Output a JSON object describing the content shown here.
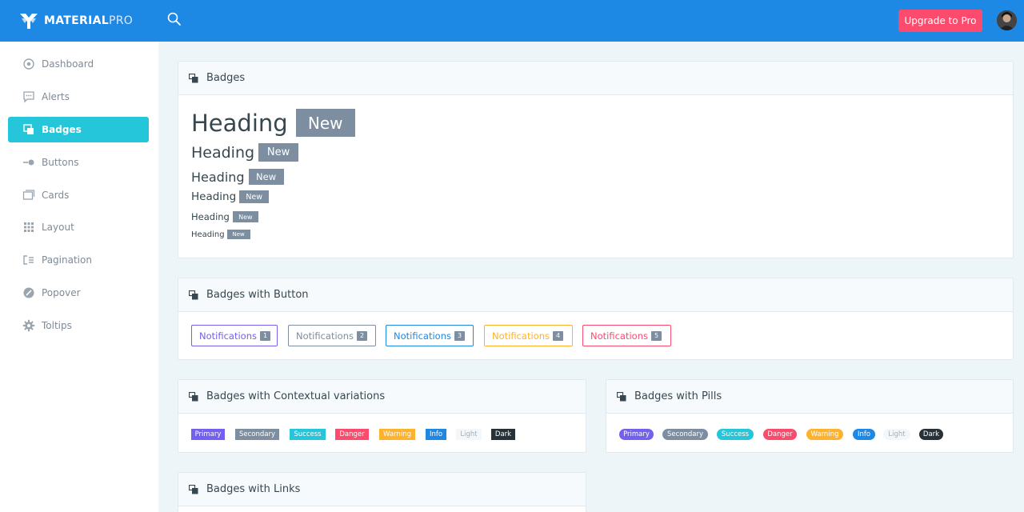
{
  "app": {
    "logo_bold": "MATERIAL",
    "logo_thin": "PRO",
    "upgrade_label": "Upgrade to Pro"
  },
  "sidebar": {
    "items": [
      {
        "label": "Dashboard",
        "icon": "dashboard-icon"
      },
      {
        "label": "Alerts",
        "icon": "alerts-icon"
      },
      {
        "label": "Badges",
        "icon": "badges-icon",
        "active": true
      },
      {
        "label": "Buttons",
        "icon": "buttons-icon"
      },
      {
        "label": "Cards",
        "icon": "cards-icon"
      },
      {
        "label": "Layout",
        "icon": "layout-icon"
      },
      {
        "label": "Pagination",
        "icon": "pagination-icon"
      },
      {
        "label": "Popover",
        "icon": "popover-icon"
      },
      {
        "label": "Toltips",
        "icon": "tooltips-icon"
      }
    ]
  },
  "cards": {
    "badges": {
      "title": "Badges",
      "headings": [
        {
          "text": "Heading",
          "badge": "New"
        },
        {
          "text": "Heading",
          "badge": "New"
        },
        {
          "text": "Heading",
          "badge": "New"
        },
        {
          "text": "Heading",
          "badge": "New"
        },
        {
          "text": "Heading",
          "badge": "New"
        },
        {
          "text": "Heading",
          "badge": "New"
        }
      ]
    },
    "badges_button": {
      "title": "Badges with Button",
      "buttons": [
        {
          "label": "Notifications",
          "count": "1",
          "color": "#7460ee"
        },
        {
          "label": "Notifications",
          "count": "2",
          "color": "#7c8ea0"
        },
        {
          "label": "Notifications",
          "count": "3",
          "color": "#1e88e5"
        },
        {
          "label": "Notifications",
          "count": "4",
          "color": "#ffb22b"
        },
        {
          "label": "Notifications",
          "count": "5",
          "color": "#fc4b6c"
        }
      ]
    },
    "contextual": {
      "title": "Badges with Contextual variations",
      "badges": [
        {
          "label": "Primary",
          "color": "#7460ee"
        },
        {
          "label": "Secondary",
          "color": "#7c8ea0"
        },
        {
          "label": "Success",
          "color": "#26c6da"
        },
        {
          "label": "Danger",
          "color": "#fc4b6c"
        },
        {
          "label": "Warning",
          "color": "#ffb22b"
        },
        {
          "label": "Info",
          "color": "#1e88e5"
        },
        {
          "label": "Light",
          "color": "#f4f7fa"
        },
        {
          "label": "Dark",
          "color": "#263238"
        }
      ]
    },
    "pills": {
      "title": "Badges with Pills",
      "badges": [
        {
          "label": "Primary",
          "color": "#7460ee"
        },
        {
          "label": "Secondary",
          "color": "#7c8ea0"
        },
        {
          "label": "Success",
          "color": "#26c6da"
        },
        {
          "label": "Danger",
          "color": "#fc4b6c"
        },
        {
          "label": "Warning",
          "color": "#ffb22b"
        },
        {
          "label": "Info",
          "color": "#1e88e5"
        },
        {
          "label": "Light",
          "color": "#f4f7fa"
        },
        {
          "label": "Dark",
          "color": "#263238"
        }
      ]
    },
    "links": {
      "title": "Badges with Links"
    }
  }
}
